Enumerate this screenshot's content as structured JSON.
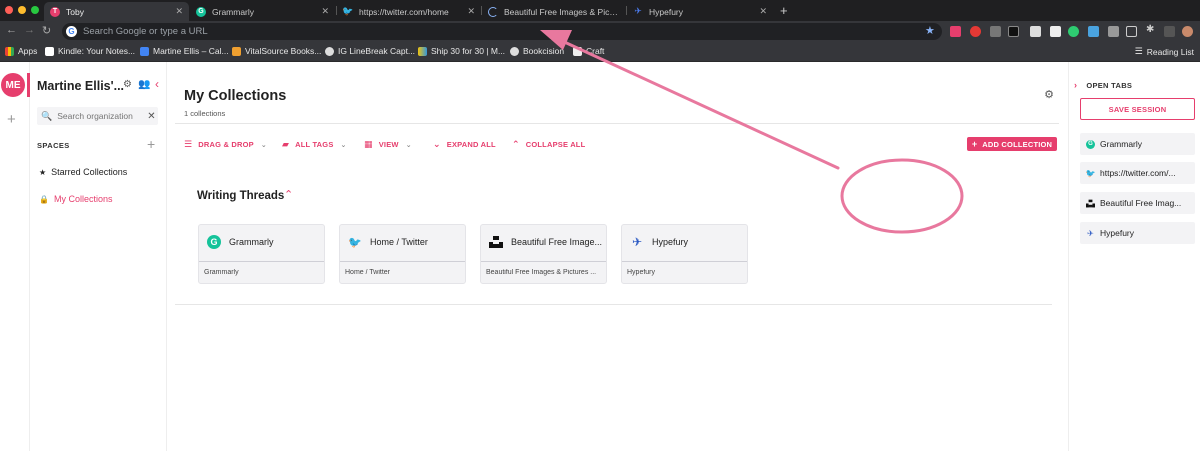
{
  "browser": {
    "tabs": [
      {
        "label": "Toby",
        "icon": "toby-icon",
        "color": "#e63e6d",
        "glyph": "T"
      },
      {
        "label": "Grammarly",
        "icon": "grammarly-icon",
        "color": "#15c39a",
        "glyph": "G"
      },
      {
        "label": "https://twitter.com/home",
        "icon": "twitter-icon",
        "color": "#1da1f2",
        "glyph": "t"
      },
      {
        "label": "Beautiful Free Images & Pictures",
        "icon": "loading-icon",
        "color": "#888888",
        "glyph": ""
      },
      {
        "label": "Hypefury",
        "icon": "hypefury-icon",
        "color": "#2b59c3",
        "glyph": "h"
      }
    ],
    "address_placeholder": "Search Google or type a URL",
    "bookmarks": [
      {
        "label": "Apps",
        "icon": "apps-grid-icon"
      },
      {
        "label": "Kindle: Your Notes...",
        "icon": "kindle-icon"
      },
      {
        "label": "Martine Ellis – Cal...",
        "icon": "calendar-icon"
      },
      {
        "label": "VitalSource Books...",
        "icon": "vitalsource-icon"
      },
      {
        "label": "IG LineBreak Capt...",
        "icon": "globe-icon"
      },
      {
        "label": "Ship 30 for 30 | M...",
        "icon": "ship30-icon"
      },
      {
        "label": "Bookcision",
        "icon": "globe-icon"
      },
      {
        "label": "Craft",
        "icon": "craft-icon"
      }
    ],
    "reading_list": "Reading List"
  },
  "rail": {
    "avatar": "ME"
  },
  "sidebar": {
    "org_name": "Martine Ellis'...",
    "search_placeholder": "Search organization",
    "spaces_label": "SPACES",
    "items": [
      {
        "label": "Starred Collections",
        "icon": "star-icon"
      },
      {
        "label": "My Collections",
        "icon": "lock-icon"
      }
    ]
  },
  "main": {
    "title": "My Collections",
    "subtitle": "1 collections",
    "toolbar": {
      "drag_drop": "DRAG & DROP",
      "all_tags": "ALL TAGS",
      "view": "VIEW",
      "expand_all": "EXPAND ALL",
      "collapse_all": "COLLAPSE ALL",
      "add_collection": "ADD COLLECTION"
    },
    "collection": {
      "title": "Writing Threads",
      "cards": [
        {
          "title": "Grammarly",
          "subtitle": "Grammarly",
          "icon": "grammarly-icon",
          "color": "#15c39a",
          "glyph": "G"
        },
        {
          "title": "Home / Twitter",
          "subtitle": "Home / Twitter",
          "icon": "twitter-icon",
          "color": "#1da1f2",
          "glyph": "🐦"
        },
        {
          "title": "Beautiful Free Image...",
          "subtitle": "Beautiful Free Images & Pictures ...",
          "icon": "unsplash-icon",
          "color": "#111111",
          "glyph": ""
        },
        {
          "title": "Hypefury",
          "subtitle": "Hypefury",
          "icon": "hypefury-icon",
          "color": "#2b59c3",
          "glyph": ""
        }
      ]
    }
  },
  "right_panel": {
    "heading": "OPEN TABS",
    "save_session": "SAVE SESSION",
    "tabs": [
      {
        "label": "Grammarly",
        "icon": "grammarly-icon",
        "color": "#15c39a",
        "glyph": "G"
      },
      {
        "label": "https://twitter.com/...",
        "icon": "twitter-icon",
        "color": "#1da1f2",
        "glyph": ""
      },
      {
        "label": "Beautiful Free Imag...",
        "icon": "unsplash-icon",
        "color": "#111111",
        "glyph": ""
      },
      {
        "label": "Hypefury",
        "icon": "hypefury-icon",
        "color": "#2b59c3",
        "glyph": ""
      }
    ]
  },
  "colors": {
    "accent": "#e63e6d",
    "annotation": "#e8789e"
  }
}
